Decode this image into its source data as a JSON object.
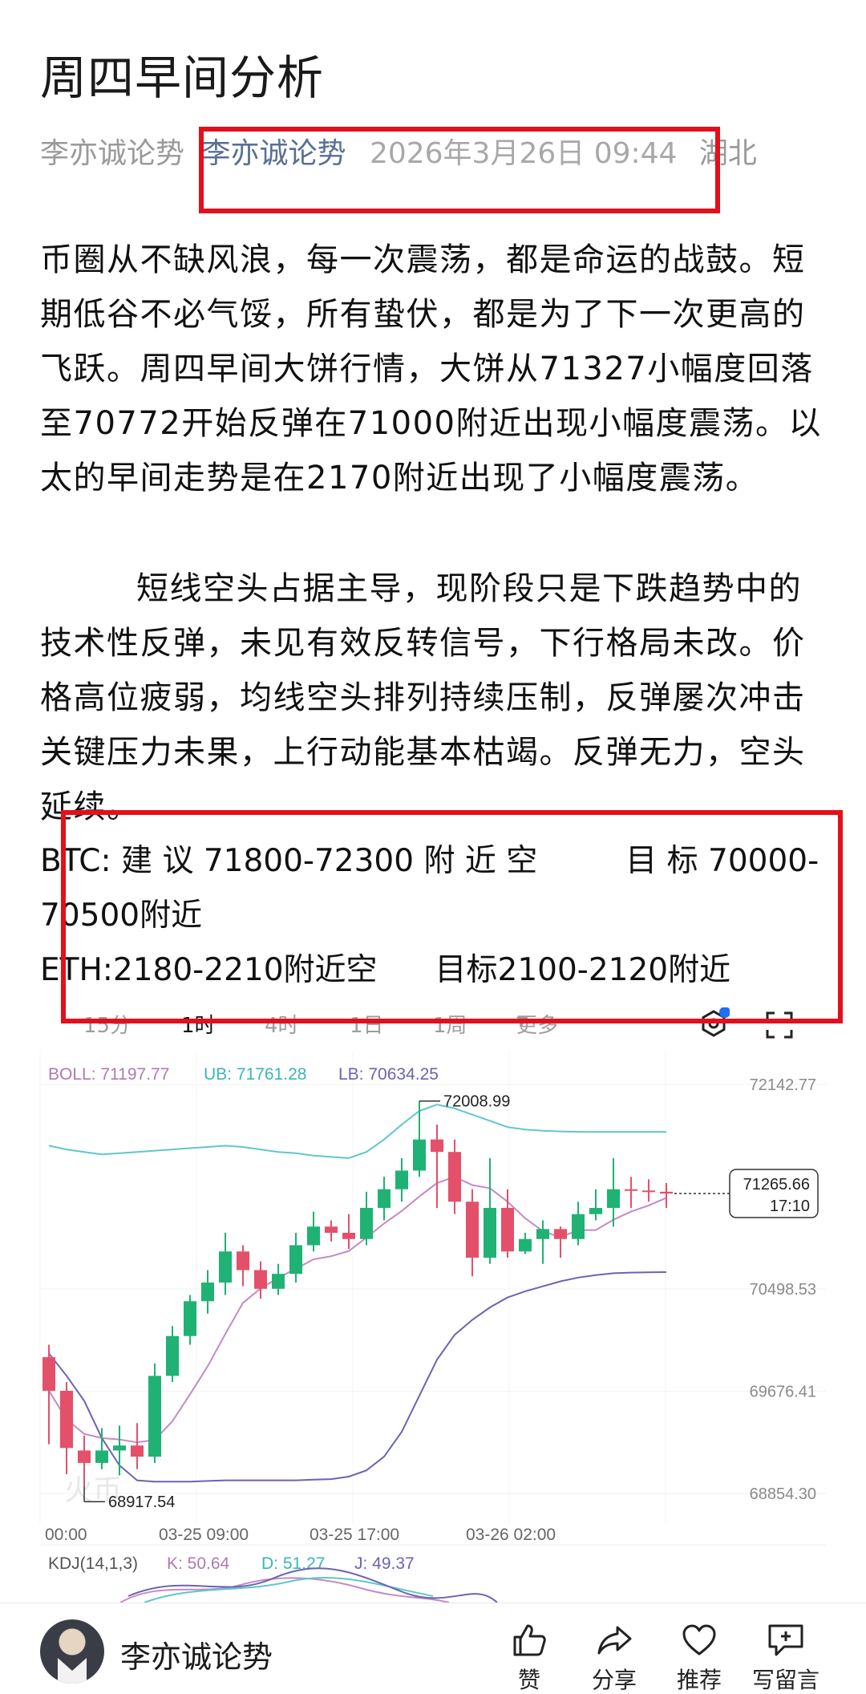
{
  "article": {
    "title": "周四早间分析",
    "meta": {
      "source": "李亦诚论势",
      "author": "李亦诚论势",
      "date": "2026年3月26日 09:44",
      "location": "湖北"
    },
    "paragraph1": "币圈从不缺风浪，每一次震荡，都是命运的战鼓。短期低谷不必气馁，所有蛰伏，都是为了下一次更高的飞跃。周四早间大饼行情，大饼从71327小幅度回落至70772开始反弹在71000附近出现小幅度震荡。以太的早间走势是在2170附近出现了小幅度震荡。",
    "paragraph2": "短线空头占据主导，现阶段只是下跌趋势中的技术性反弹，未见有效反转信号，下行格局未改。价格高位疲弱，均线空头排列持续压制，反弹屡次冲击关键压力未果，上行动能基本枯竭。反弹无力，空头延续。",
    "btc_line_a": "BTC: 建 议 71800-72300 附 近 空",
    "btc_target": "目 标 70000-",
    "btc_line_b": "70500附近",
    "eth_line_a": "ETH:2180-2210附近空",
    "eth_target": "目标2100-2120附近"
  },
  "chart_toolbar": {
    "tabs": [
      "15分",
      "1时",
      "4时",
      "1日",
      "1周",
      "更多"
    ],
    "active_tab": "1时",
    "more_arrow": "▾",
    "icons": [
      "settings-icon",
      "fullscreen-icon"
    ]
  },
  "chart_data": {
    "type": "candlestick",
    "indicator": {
      "boll": "BOLL: 71197.77",
      "ub": "UB: 71761.28",
      "lb": "LB: 70634.25"
    },
    "colors": {
      "up": "#1fb274",
      "down": "#e4506a",
      "ub": "#5ec8c8",
      "boll": "#c58ac4",
      "lb": "#6a64b4"
    },
    "y_ticks": [
      "72142.77",
      "70498.53",
      "69676.41",
      "68854.30"
    ],
    "y_tick_values": [
      72142.77,
      70498.53,
      69676.41,
      68854.3
    ],
    "x_ticks": [
      "00:00",
      "03-25 09:00",
      "03-25 17:00",
      "03-26 02:00"
    ],
    "high_label": "72008.99",
    "low_label": "68917.54",
    "last_price": "71265.66",
    "last_time": "17:10",
    "watermark": "火币",
    "candles": [
      [
        69950,
        69680,
        69250,
        70050
      ],
      [
        69680,
        69220,
        69010,
        69750
      ],
      [
        69200,
        69100,
        68917.54,
        69320
      ],
      [
        69100,
        69200,
        69050,
        69380
      ],
      [
        69200,
        69240,
        69000,
        69400
      ],
      [
        69240,
        69150,
        69050,
        69420
      ],
      [
        69150,
        69800,
        69100,
        69900
      ],
      [
        69800,
        70120,
        69750,
        70200
      ],
      [
        70120,
        70400,
        70050,
        70450
      ],
      [
        70400,
        70550,
        70300,
        70650
      ],
      [
        70550,
        70800,
        70450,
        70950
      ],
      [
        70800,
        70650,
        70520,
        70850
      ],
      [
        70650,
        70500,
        70420,
        70720
      ],
      [
        70500,
        70620,
        70450,
        70700
      ],
      [
        70620,
        70850,
        70550,
        70950
      ],
      [
        70850,
        71000,
        70800,
        71120
      ],
      [
        71000,
        70950,
        70880,
        71050
      ],
      [
        70950,
        70900,
        70820,
        71100
      ],
      [
        70900,
        71150,
        70850,
        71280
      ],
      [
        71150,
        71300,
        71050,
        71400
      ],
      [
        71300,
        71450,
        71200,
        71550
      ],
      [
        71450,
        71700,
        71400,
        72008.99
      ],
      [
        71700,
        71600,
        71150,
        71820
      ],
      [
        71600,
        71200,
        71100,
        71700
      ],
      [
        71200,
        70750,
        70600,
        71300
      ],
      [
        70750,
        71150,
        70700,
        71550
      ],
      [
        71150,
        70800,
        70750,
        71300
      ],
      [
        70800,
        70900,
        70780,
        70950
      ],
      [
        70900,
        70980,
        70700,
        71050
      ],
      [
        70980,
        70900,
        70750,
        71000
      ],
      [
        70900,
        71100,
        70850,
        71200
      ],
      [
        71100,
        71150,
        71050,
        71300
      ],
      [
        71150,
        71300,
        71000,
        71550
      ],
      [
        71300,
        71290,
        71150,
        71400
      ],
      [
        71290,
        71280,
        71200,
        71380
      ],
      [
        71280,
        71265.66,
        71150,
        71350
      ]
    ],
    "kdj": {
      "label": "KDJ(14,1,3)",
      "k": "K: 50.64",
      "d": "D: 51.27",
      "j": "J: 49.37"
    }
  },
  "bottom_bar": {
    "account_name": "李亦诚论势",
    "actions": [
      {
        "label": "赞",
        "icon": "thumbs-up-icon"
      },
      {
        "label": "分享",
        "icon": "share-icon"
      },
      {
        "label": "推荐",
        "icon": "heart-icon"
      },
      {
        "label": "写留言",
        "icon": "comment-icon"
      }
    ]
  }
}
